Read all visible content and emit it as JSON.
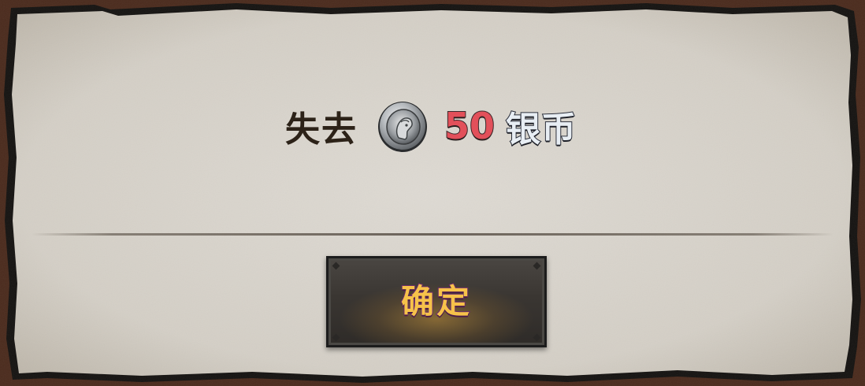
{
  "dialog": {
    "message_prefix": "失去",
    "coin_icon": "silver-coin-icon",
    "amount": "50",
    "currency": "银币",
    "confirm_label": "确定"
  },
  "colors": {
    "paper": "#d8d4cc",
    "frame_wood": "#4a2a1c",
    "amount": "#e2505a",
    "currency": "#e8eef4",
    "button_text": "#f6c24a",
    "button_outline": "#6a2a6a"
  }
}
